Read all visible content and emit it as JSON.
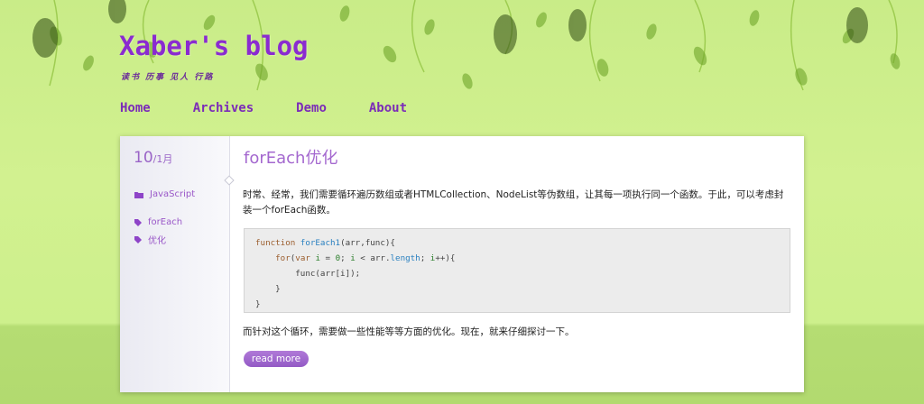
{
  "blog": {
    "title": "Xaber's blog",
    "subtitle": "读书 历事 见人 行路"
  },
  "nav": [
    {
      "label": "Home"
    },
    {
      "label": "Archives"
    },
    {
      "label": "Demo"
    },
    {
      "label": "About"
    }
  ],
  "post": {
    "date": {
      "day": "10",
      "month": "/1月"
    },
    "category": "JavaScript",
    "tags": [
      "forEach",
      "优化"
    ],
    "title": "forEach优化",
    "paragraph1": "时常、经常，我们需要循环遍历数组或者HTMLCollection、NodeList等伪数组，让其每一项执行同一个函数。于此，可以考虑封装一个forEach函数。",
    "code": {
      "l1_kw": "function",
      "l1_fn": " forEach1",
      "l1_rest": "(arr,func){",
      "l2_indent": "    ",
      "l2_kw": "for",
      "l2_a": "(",
      "l2_var": "var",
      "l2_i": " i",
      "l2_b": " = ",
      "l2_zero": "0",
      "l2_c": "; ",
      "l2_i2": "i",
      "l2_d": " < arr.",
      "l2_len": "length",
      "l2_e": "; ",
      "l2_i3": "i",
      "l2_f": "++){",
      "l3": "        func(arr[i]);",
      "l4": "    }",
      "l5": "}"
    },
    "paragraph2": "而针对这个循环，需要做一些性能等等方面的优化。现在，就来仔细探讨一下。",
    "read_more": "read more"
  },
  "colors": {
    "accent": "#8a2bd0",
    "button": "#a36bd2",
    "background": "#d2f190"
  }
}
